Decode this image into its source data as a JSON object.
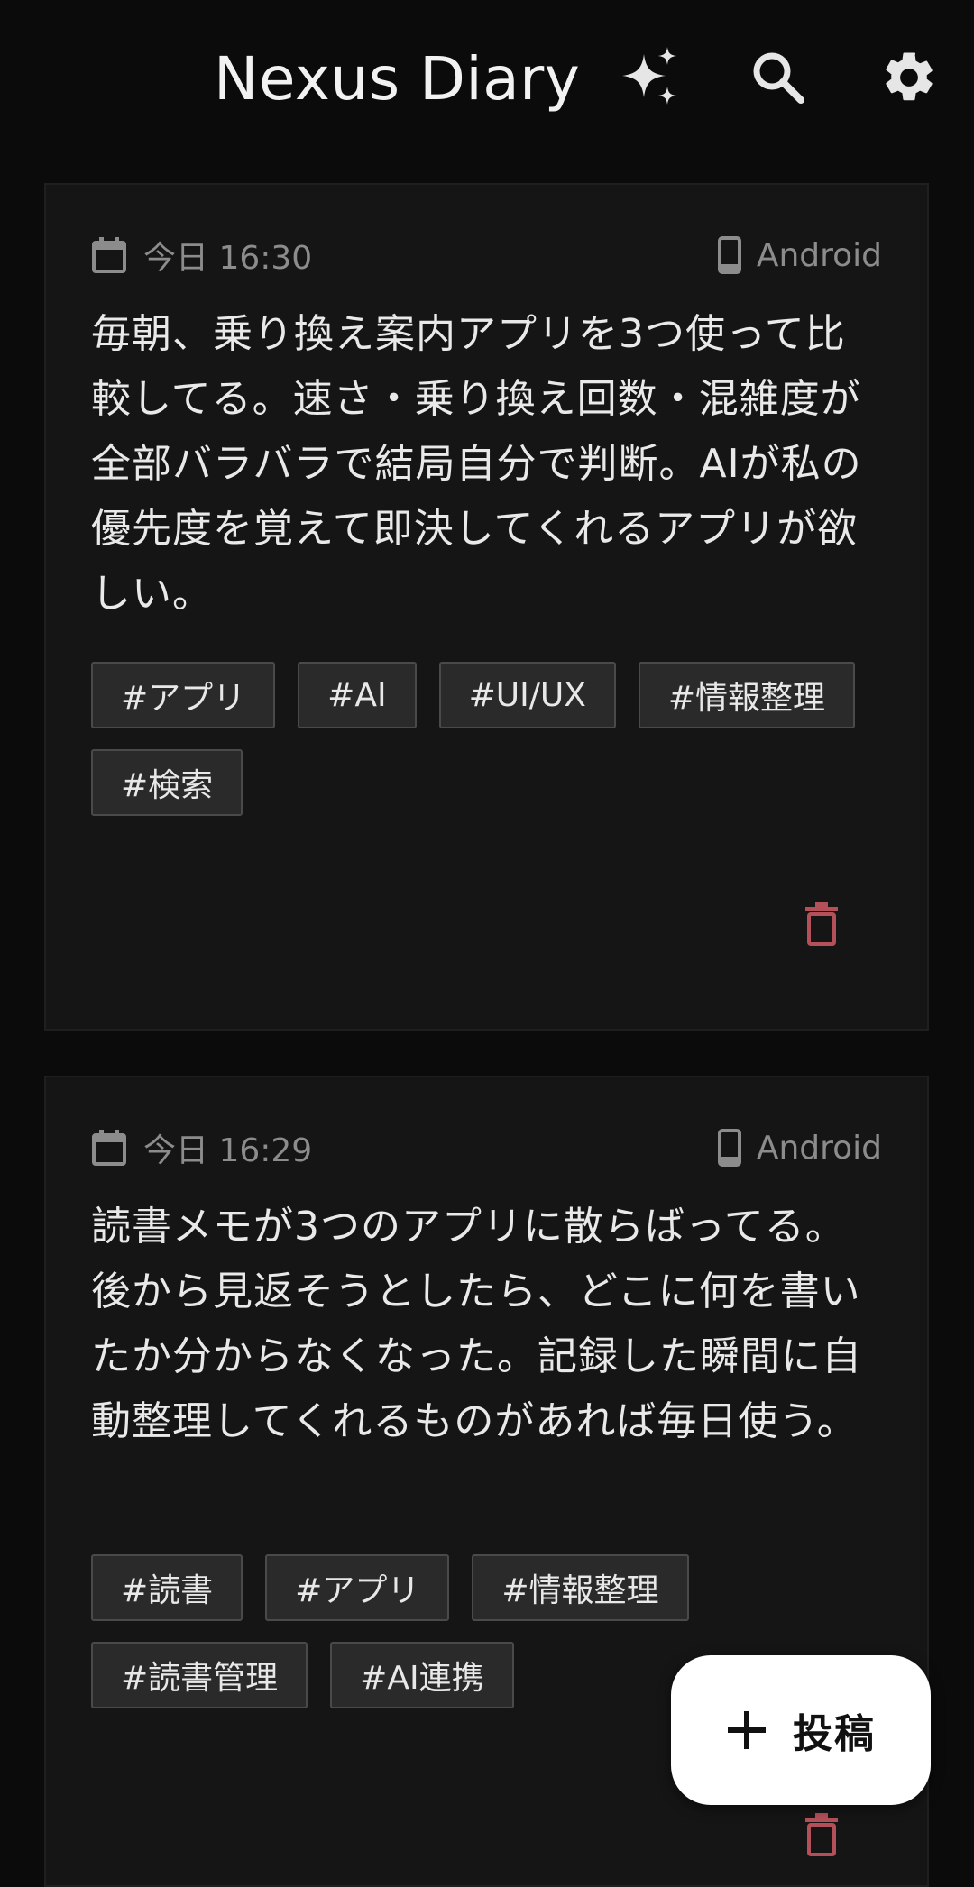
{
  "app": {
    "title": "Nexus Diary"
  },
  "toolbar": {
    "ai_icon": "sparkle-icon",
    "search_icon": "search-icon",
    "settings_icon": "gear-icon"
  },
  "entries": [
    {
      "date": "今日 16:30",
      "device": "Android",
      "text": "毎朝、乗り換え案内アプリを3つ使って比較してる。速さ・乗り換え回数・混雑度が全部バラバラで結局自分で判断。AIが私の優先度を覚えて即決してくれるアプリが欲しい。",
      "tags": [
        "#アプリ",
        "#AI",
        "#UI/UX",
        "#情報整理",
        "#検索"
      ]
    },
    {
      "date": "今日 16:29",
      "device": "Android",
      "text": "読書メモが3つのアプリに散らばってる。後から見返そうとしたら、どこに何を書いたか分からなくなった。記録した瞬間に自動整理してくれるものがあれば毎日使う。",
      "tags": [
        "#読書",
        "#アプリ",
        "#情報整理",
        "#読書管理",
        "#AI連携"
      ]
    }
  ],
  "fab": {
    "label": "投稿",
    "icon": "plus-icon"
  },
  "colors": {
    "background": "#0b0b0b",
    "card": "#151515",
    "tag_bg": "#2a2a2a",
    "delete": "#b4505a",
    "fab_bg": "#ffffff"
  }
}
